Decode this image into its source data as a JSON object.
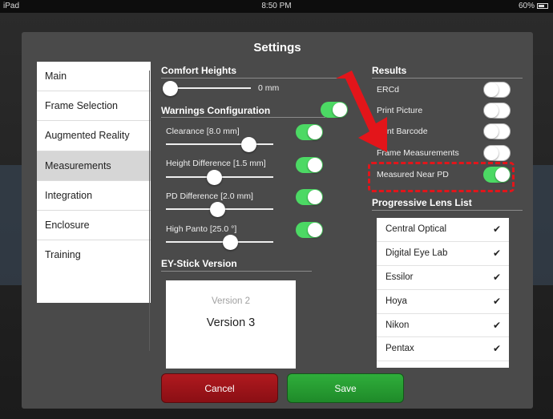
{
  "status_bar": {
    "device": "iPad",
    "time": "8:50 PM",
    "battery": "60%"
  },
  "modal": {
    "title": "Settings"
  },
  "menu": {
    "items": [
      {
        "label": "Main",
        "active": false
      },
      {
        "label": "Frame Selection",
        "active": false
      },
      {
        "label": "Augmented Reality",
        "active": false
      },
      {
        "label": "Measurements",
        "active": true
      },
      {
        "label": "Integration",
        "active": false
      },
      {
        "label": "Enclosure",
        "active": false
      },
      {
        "label": "Training",
        "active": false
      }
    ]
  },
  "comfort_heights": {
    "title": "Comfort Heights",
    "value": "0 mm"
  },
  "warnings": {
    "title": "Warnings Configuration",
    "enabled": true,
    "items": [
      {
        "label": "Clearance  [8.0 mm]",
        "enabled": true,
        "level": 0.82
      },
      {
        "label": "Height Difference  [1.5 mm]",
        "enabled": true,
        "level": 0.44
      },
      {
        "label": "PD Difference  [2.0 mm]",
        "enabled": true,
        "level": 0.48
      },
      {
        "label": "High Panto  [25.0 °]",
        "enabled": true,
        "level": 0.62
      }
    ]
  },
  "ey_stick": {
    "title": "EY-Stick Version",
    "options": [
      "Version 2",
      "Version 3"
    ],
    "selected": "Version 3"
  },
  "results": {
    "title": "Results",
    "items": [
      {
        "label": "ERCd",
        "enabled": false
      },
      {
        "label": "Print Picture",
        "enabled": false
      },
      {
        "label": "Print Barcode",
        "enabled": false
      },
      {
        "label": "Frame Measurements",
        "enabled": false
      },
      {
        "label": "Measured Near PD",
        "enabled": true
      }
    ]
  },
  "lens_list": {
    "title": "Progressive Lens List",
    "items": [
      {
        "label": "Central Optical",
        "checked": true
      },
      {
        "label": "Digital Eye Lab",
        "checked": true
      },
      {
        "label": "Essilor",
        "checked": true
      },
      {
        "label": "Hoya",
        "checked": true
      },
      {
        "label": "Nikon",
        "checked": true
      },
      {
        "label": "Pentax",
        "checked": true
      }
    ]
  },
  "buttons": {
    "cancel": "Cancel",
    "save": "Save"
  },
  "colors": {
    "toggle_on": "#4cd964",
    "cancel": "#a0161b",
    "save": "#27a032",
    "annotation": "#e3151a"
  },
  "check_glyph": "✔"
}
